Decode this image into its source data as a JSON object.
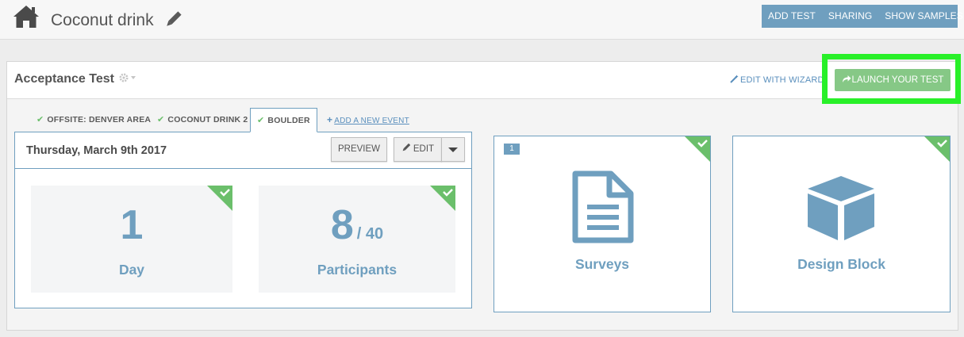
{
  "header": {
    "title": "Coconut drink",
    "actions": [
      "ADD TEST",
      "SHARING",
      "SHOW SAMPLES"
    ]
  },
  "test": {
    "title": "Acceptance Test",
    "wizard_link": "EDIT WITH WIZARD",
    "launch_button": "LAUNCH YOUR TEST"
  },
  "tabs": [
    {
      "label": "OFFSITE: DENVER AREA",
      "checked": true
    },
    {
      "label": "COCONUT DRINK 2",
      "checked": true
    },
    {
      "label": "BOULDER",
      "checked": true,
      "active": true
    }
  ],
  "add_event": "ADD A NEW EVENT",
  "event": {
    "date": "Thursday, March 9th 2017",
    "preview_label": "PREVIEW",
    "edit_label": "EDIT",
    "stats": [
      {
        "value": "1",
        "label": "Day"
      },
      {
        "value": "8",
        "total": "/ 40",
        "label": "Participants"
      }
    ]
  },
  "cards": [
    {
      "label": "Surveys",
      "badge": "1",
      "icon": "document-icon"
    },
    {
      "label": "Design Block",
      "icon": "cube-icon"
    }
  ],
  "colors": {
    "accent": "#6f9fbf",
    "success": "#6bbf6b",
    "launch": "#86c886",
    "highlight": "#28f028"
  }
}
